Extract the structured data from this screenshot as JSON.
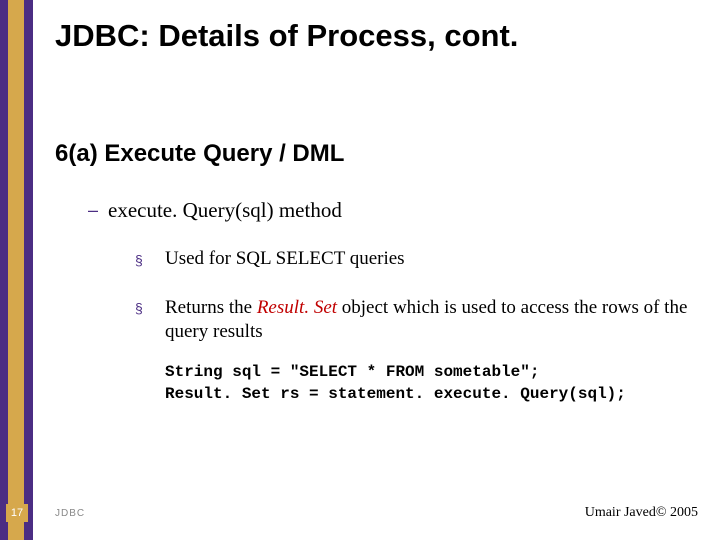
{
  "title": "JDBC: Details of Process, cont.",
  "section": "6(a)  Execute Query / DML",
  "sub1": "execute. Query(sql) method",
  "item1": "Used for SQL SELECT queries",
  "item2_pre": "Returns the ",
  "item2_em": "Result. Set",
  "item2_post": " object which is used to access the rows of the query results",
  "code": "String sql = \"SELECT * FROM sometable\";\nResult. Set rs = statement. execute. Query(sql);",
  "footer_num": "17",
  "footer_jdbc": "JDBC",
  "footer_right": "Umair Javed© 2005"
}
